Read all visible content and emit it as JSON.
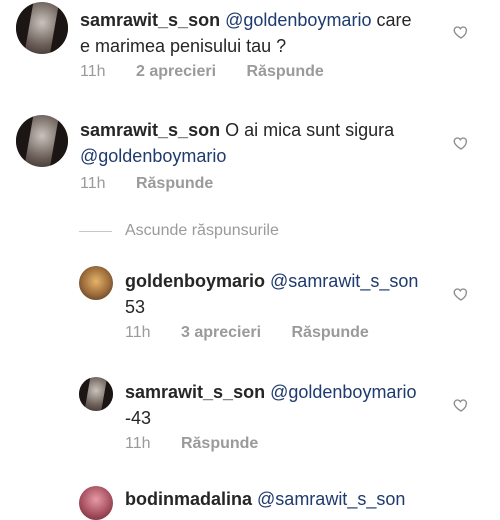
{
  "comments": [
    {
      "username": "samrawit_s_son",
      "mention": "@goldenboymario",
      "text_line1": " care",
      "text_line2": "e marimea penisului tau ?",
      "time": "11h",
      "likes": "2 aprecieri",
      "reply": "Răspunde"
    },
    {
      "username": "samrawit_s_son",
      "text": " O ai mica sunt sigura",
      "mention": "@goldenboymario",
      "time": "11h",
      "reply": "Răspunde"
    }
  ],
  "hide_replies_label": "Ascunde răspunsurile",
  "replies": [
    {
      "username": "goldenboymario",
      "mention": "@samrawit_s_son",
      "text": "53",
      "time": "11h",
      "likes": "3 aprecieri",
      "reply": "Răspunde"
    },
    {
      "username": "samrawit_s_son",
      "mention": "@goldenboymario",
      "text": "-43",
      "time": "11h",
      "reply": "Răspunde"
    },
    {
      "username": "bodinmadalina",
      "mention": "@samrawit_s_son"
    }
  ],
  "colors": {
    "mention": "#1e3a6e",
    "meta": "#9a9a9a",
    "text": "#262626"
  }
}
